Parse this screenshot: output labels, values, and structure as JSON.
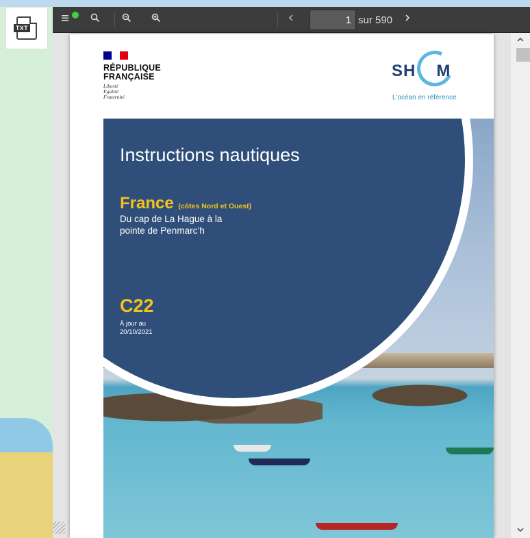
{
  "toolbar": {
    "menu_icon": "menu-icon",
    "search_icon": "search-icon",
    "zoom_in_icon": "zoom-in-icon",
    "zoom_out_icon": "zoom-out-icon",
    "prev_icon": "chevron-left-icon",
    "next_icon": "chevron-right-icon",
    "page_current": "1",
    "page_total": "sur 590"
  },
  "side": {
    "txt_label": "TXT"
  },
  "document": {
    "republic_name_line1": "RÉPUBLIQUE",
    "republic_name_line2": "FRANÇAISE",
    "motto_1": "Liberté",
    "motto_2": "Égalité",
    "motto_3": "Fraternité",
    "shom_text_left": "SH",
    "shom_text_right": "M",
    "shom_tagline": "L'océan en référence",
    "title": "Instructions nautiques",
    "region": "France",
    "region_detail": "(côtes Nord et Ouest)",
    "subtitle_line1": "Du cap de La Hague à la",
    "subtitle_line2": "pointe de Penmarc’h",
    "code": "C22",
    "update_label": "À jour au",
    "update_date": "20/10/2021"
  },
  "colors": {
    "toolbar_bg": "#3c3c3c",
    "cover_panel": "#2f4f7a",
    "accent_yellow": "#f6c21a",
    "shom_blue": "#1f3f6e",
    "shom_light_blue": "#5bb7e0",
    "status_green": "#3fd13f",
    "flag_blue": "#000091",
    "flag_red": "#e1000f"
  }
}
